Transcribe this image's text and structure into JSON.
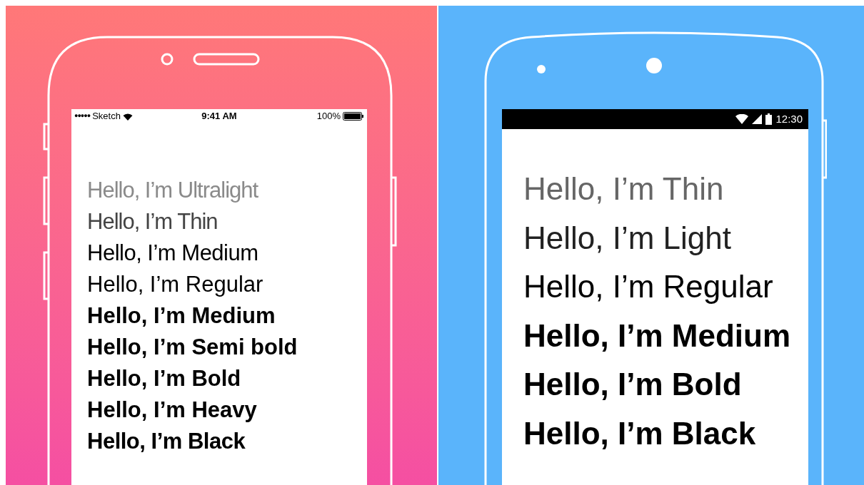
{
  "ios_phone": {
    "status_bar": {
      "carrier_dots": "●●●●●",
      "carrier": "Sketch",
      "time": "9:41 AM",
      "battery": "100%"
    },
    "samples": [
      "Hello, I’m Ultralight",
      "Hello, I’m Thin",
      "Hello, I’m Medium",
      "Hello, I’m Regular",
      "Hello, I’m Medium",
      "Hello, I’m Semi bold",
      "Hello, I’m Bold",
      "Hello, I’m Heavy",
      "Hello, I’m Black"
    ]
  },
  "android_phone": {
    "status_bar": {
      "time": "12:30"
    },
    "samples": [
      "Hello, I’m Thin",
      "Hello, I’m Light",
      "Hello, I’m Regular",
      "Hello, I’m Medium",
      "Hello, I’m Bold",
      "Hello, I’m Black"
    ]
  }
}
